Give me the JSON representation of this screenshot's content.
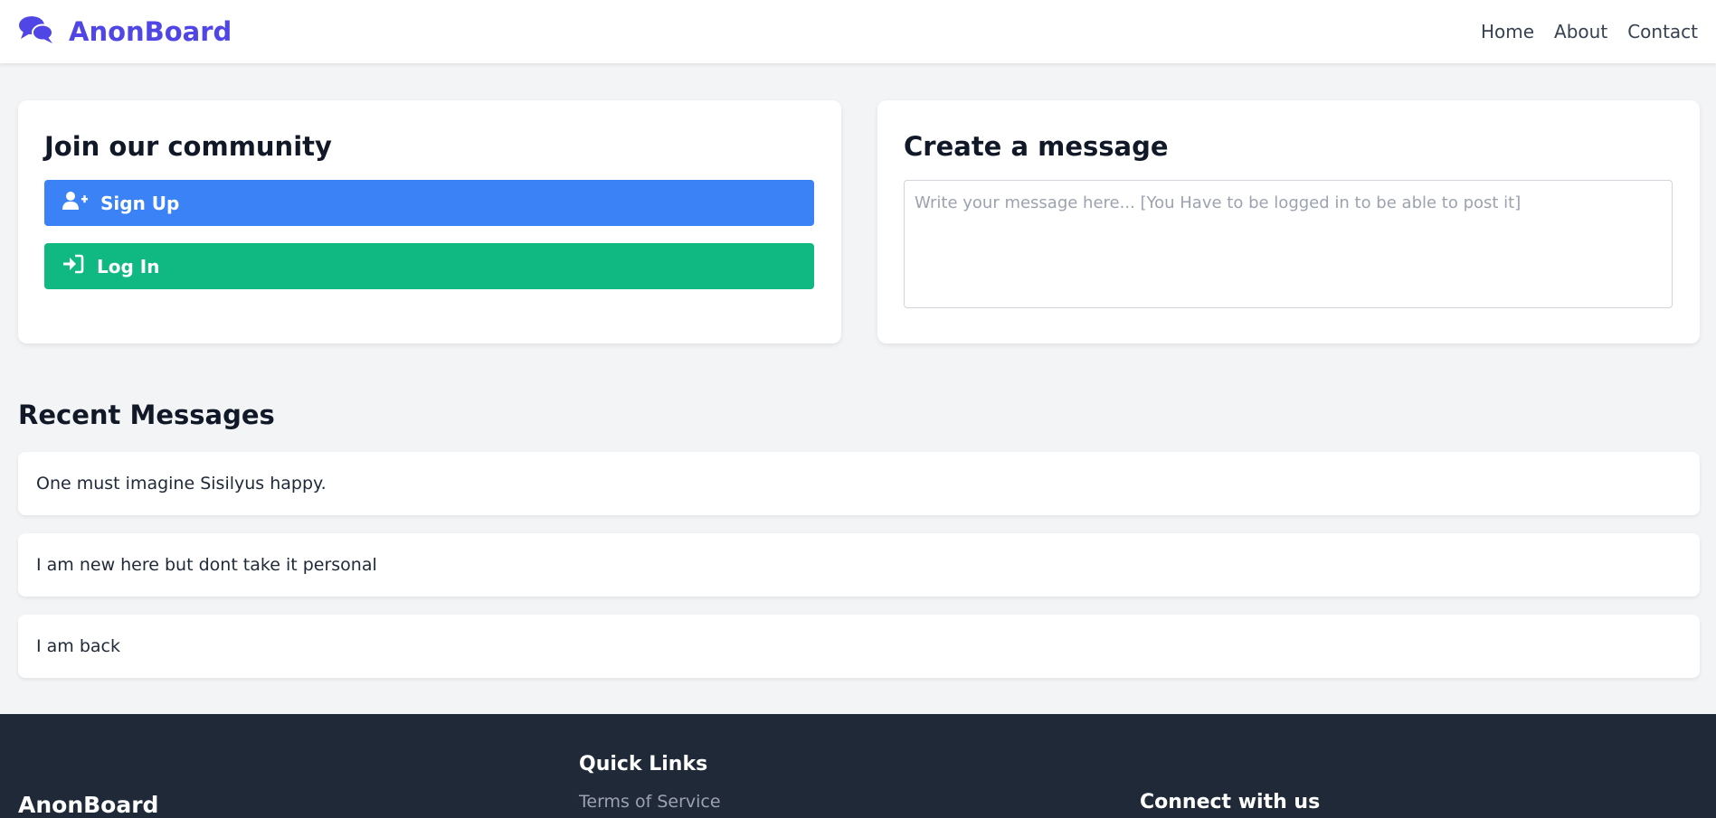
{
  "header": {
    "brand": "AnonBoard",
    "nav": [
      "Home",
      "About",
      "Contact"
    ]
  },
  "join_card": {
    "title": "Join our community",
    "signup_label": "Sign Up",
    "login_label": "Log In"
  },
  "create_card": {
    "title": "Create a message",
    "placeholder": "Write your message here... [You Have to be logged in to be able to post it]"
  },
  "recent": {
    "title": "Recent Messages",
    "messages": [
      "One must imagine Sisilyus happy.",
      "I am new here but dont take it personal",
      "I am back"
    ]
  },
  "footer": {
    "brand": "AnonBoard",
    "quick_links_title": "Quick Links",
    "terms_link": "Terms of Service",
    "connect_title": "Connect with us"
  },
  "colors": {
    "brand": "#4f46e5",
    "signup": "#3b82f6",
    "login": "#10b981",
    "footer_bg": "#1f2937"
  },
  "icons": {
    "brand": "comments-icon",
    "signup": "user-plus-icon",
    "login": "sign-in-icon"
  }
}
